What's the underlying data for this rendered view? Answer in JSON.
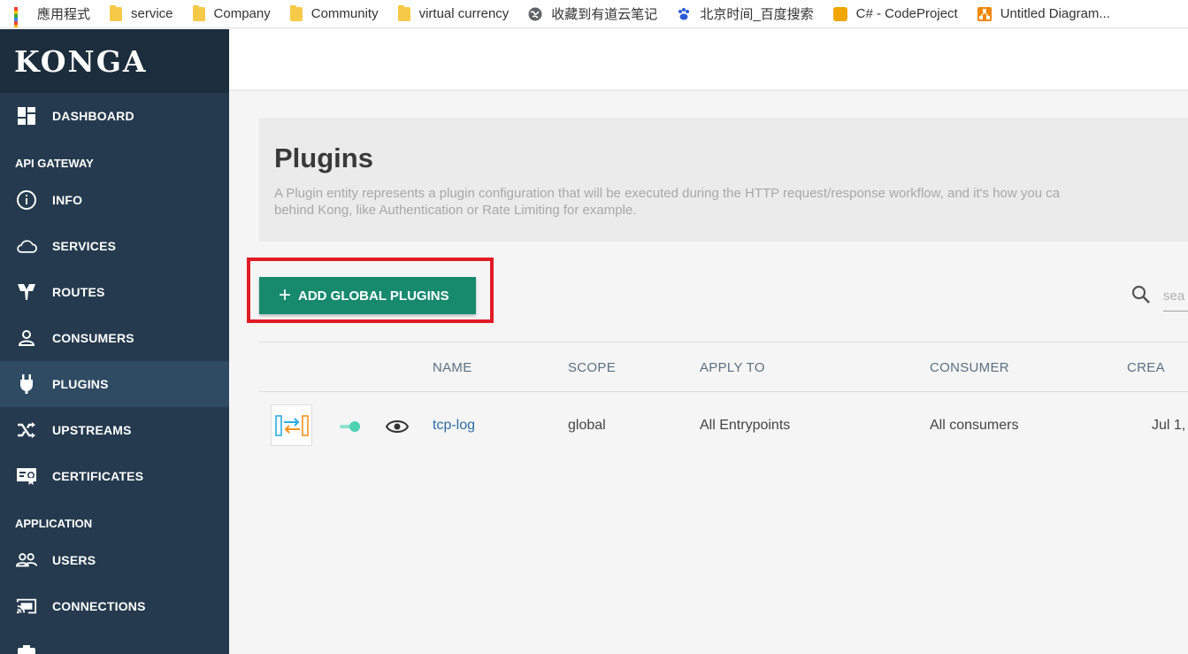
{
  "bookmarks": [
    {
      "label": "應用程式",
      "icon": "apps-grid-icon"
    },
    {
      "label": "service",
      "icon": "folder-icon"
    },
    {
      "label": "Company",
      "icon": "folder-icon"
    },
    {
      "label": "Community",
      "icon": "folder-icon"
    },
    {
      "label": "virtual currency",
      "icon": "folder-icon"
    },
    {
      "label": "收藏到有道云笔记",
      "icon": "globe-icon"
    },
    {
      "label": "北京时间_百度搜索",
      "icon": "baidu-paw-icon"
    },
    {
      "label": "C# - CodeProject",
      "icon": "codeproject-icon"
    },
    {
      "label": "Untitled Diagram...",
      "icon": "drawio-icon"
    }
  ],
  "sidebar": {
    "brand": "KONGA",
    "dashboard": "DASHBOARD",
    "section_api": "API GATEWAY",
    "api_items": [
      "INFO",
      "SERVICES",
      "ROUTES",
      "CONSUMERS",
      "PLUGINS",
      "UPSTREAMS",
      "CERTIFICATES"
    ],
    "section_app": "APPLICATION",
    "app_items": [
      "USERS",
      "CONNECTIONS"
    ]
  },
  "page": {
    "title": "Plugins",
    "description": "A Plugin entity represents a plugin configuration that will be executed during the HTTP request/response workflow, and it's how you ca\nbehind Kong, like Authentication or Rate Limiting for example.",
    "add_button": "ADD GLOBAL PLUGINS",
    "search_placeholder": "sea"
  },
  "table": {
    "headers": [
      "NAME",
      "SCOPE",
      "APPLY TO",
      "CONSUMER",
      "CREA"
    ],
    "rows": [
      {
        "name": "tcp-log",
        "scope": "global",
        "apply_to": "All Entrypoints",
        "consumer": "All consumers",
        "created": "Jul 1,",
        "enabled": true
      }
    ]
  },
  "colors": {
    "sidebar_bg": "#253a4e",
    "brand_bg": "#1c2d3d",
    "active_item_bg": "#2f4a63",
    "primary_button": "#178a6e",
    "highlight_box": "#e01b24",
    "toggle_on": "#4fd1b5"
  }
}
